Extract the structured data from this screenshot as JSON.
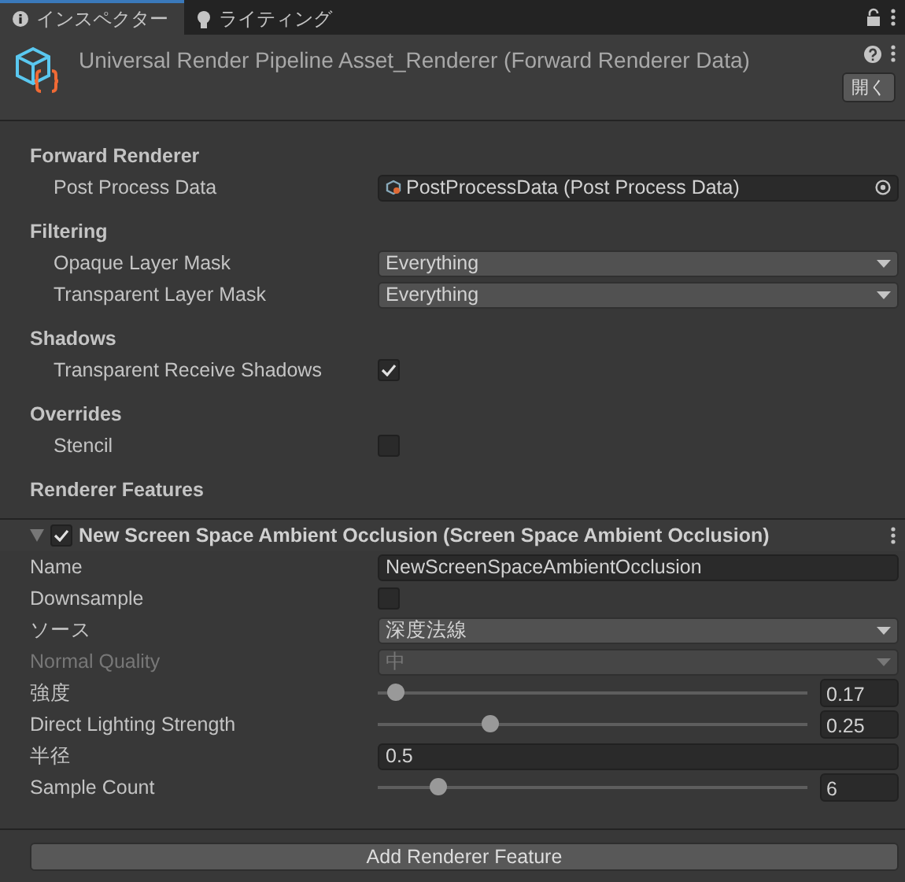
{
  "tabs": [
    {
      "label": "インスペクター",
      "kind": "info",
      "selected": true
    },
    {
      "label": "ライティング",
      "kind": "bulb",
      "selected": false
    }
  ],
  "header": {
    "title": "Universal Render Pipeline Asset_Renderer (Forward Renderer Data)",
    "open_button": "開く"
  },
  "sections": [
    {
      "title": "Forward Renderer",
      "rows": [
        {
          "label": "Post Process Data",
          "kind": "object",
          "value": "PostProcessData (Post Process Data)"
        }
      ]
    },
    {
      "title": "Filtering",
      "rows": [
        {
          "label": "Opaque Layer Mask",
          "kind": "dropdown",
          "value": "Everything"
        },
        {
          "label": "Transparent Layer Mask",
          "kind": "dropdown",
          "value": "Everything"
        }
      ]
    },
    {
      "title": "Shadows",
      "rows": [
        {
          "label": "Transparent Receive Shadows",
          "kind": "checkbox",
          "checked": true
        }
      ]
    },
    {
      "title": "Overrides",
      "rows": [
        {
          "label": "Stencil",
          "kind": "checkbox",
          "checked": false
        }
      ]
    },
    {
      "title": "Renderer Features"
    }
  ],
  "feature": {
    "title": "New Screen Space Ambient Occlusion (Screen Space Ambient Occlusion)",
    "checked": true,
    "expanded": true,
    "rows": [
      {
        "label": "Name",
        "kind": "text",
        "value": "NewScreenSpaceAmbientOcclusion",
        "disabled": false
      },
      {
        "label": "Downsample",
        "kind": "checkbox",
        "checked": false,
        "disabled": false
      },
      {
        "label": "ソース",
        "kind": "dropdown",
        "value": "深度法線",
        "disabled": false
      },
      {
        "label": "Normal Quality",
        "kind": "dropdown",
        "value": "中",
        "disabled": true
      },
      {
        "label": "強度",
        "kind": "slider",
        "level": 0.04,
        "value": "0.17",
        "disabled": false
      },
      {
        "label": "Direct Lighting Strength",
        "kind": "slider",
        "level": 0.26,
        "value": "0.25",
        "disabled": false
      },
      {
        "label": "半径",
        "kind": "text",
        "value": "0.5",
        "disabled": false
      },
      {
        "label": "Sample Count",
        "kind": "slider",
        "level": 0.14,
        "value": "6",
        "disabled": false
      }
    ]
  },
  "add_button": "Add Renderer Feature"
}
